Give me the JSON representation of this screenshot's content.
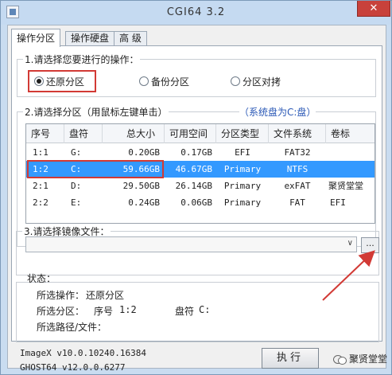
{
  "window": {
    "title": "CGI64  3.2",
    "close_label": "✕"
  },
  "tabs": [
    {
      "label": "操作分区",
      "active": true
    },
    {
      "label": "操作硬盘",
      "active": false
    },
    {
      "label": "高 级",
      "active": false
    }
  ],
  "step1": {
    "label": "1.请选择您要进行的操作：",
    "options": [
      {
        "label": "还原分区",
        "checked": true
      },
      {
        "label": "备份分区",
        "checked": false
      },
      {
        "label": "分区对拷",
        "checked": false
      }
    ]
  },
  "step2": {
    "label": "2.请选择分区（用鼠标左键单击）",
    "system_note": "（系统盘为C:盘）",
    "columns": [
      "序号",
      "盘符",
      "总大小",
      "可用空间",
      "分区类型",
      "文件系统",
      "卷标"
    ],
    "rows": [
      {
        "index": "1:1",
        "drive": "G:",
        "total": "0.20GB",
        "free": "0.17GB",
        "type": "EFI",
        "fs": "FAT32",
        "label": ""
      },
      {
        "index": "1:2",
        "drive": "C:",
        "total": "59.66GB",
        "free": "46.67GB",
        "type": "Primary",
        "fs": "NTFS",
        "label": ""
      },
      {
        "index": "2:1",
        "drive": "D:",
        "total": "29.50GB",
        "free": "26.14GB",
        "type": "Primary",
        "fs": "exFAT",
        "label": "聚贤堂堂"
      },
      {
        "index": "2:2",
        "drive": "E:",
        "total": "0.24GB",
        "free": "0.06GB",
        "type": "Primary",
        "fs": "FAT",
        "label": "EFI"
      }
    ],
    "selected_row": 1
  },
  "step3": {
    "label": "3.请选择镜像文件：",
    "file_value": "",
    "browse_label": "..."
  },
  "status": {
    "heading": "状态：",
    "operation_label": "所选操作：",
    "operation_value": "还原分区",
    "partition_label": "所选分区：",
    "partition_index_label": "序号",
    "partition_index_value": "1:2",
    "drive_label": "盘符",
    "drive_value": "C:",
    "path_label": "所选路径/文件："
  },
  "footer": {
    "imagex_version": "ImageX v10.0.10240.16384",
    "ghost_version": "GHOST64 v12.0.0.6277",
    "run_label": "执行",
    "watermark": "聚贤堂堂"
  },
  "colors": {
    "accent_red": "#d23a35",
    "selection_blue": "#3399ff",
    "note_blue": "#2a58b6"
  }
}
